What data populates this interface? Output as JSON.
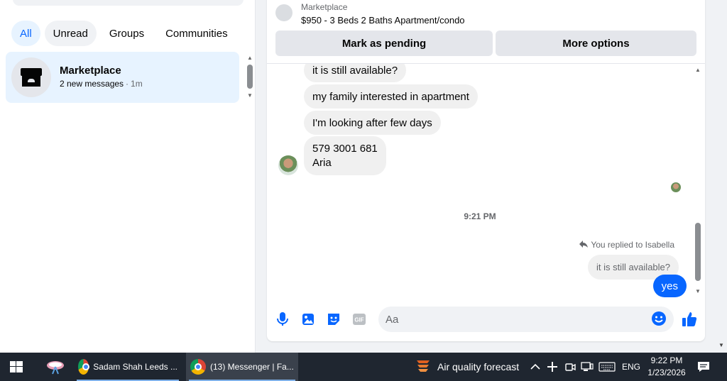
{
  "sidebar": {
    "filters": [
      {
        "label": "All",
        "active": true
      },
      {
        "label": "Unread",
        "active": false
      },
      {
        "label": "Groups",
        "active": false
      },
      {
        "label": "Communities",
        "active": false
      }
    ],
    "chats": [
      {
        "name": "Marketplace",
        "preview": "2 new messages",
        "separator": "·",
        "time": "1m",
        "icon": "marketplace-store-icon"
      }
    ]
  },
  "conversation": {
    "context": {
      "category": "Marketplace",
      "title": "$950 - 3 Beds 2 Baths Apartment/condo"
    },
    "actions": {
      "mark_pending": "Mark as pending",
      "more_options": "More options"
    },
    "incoming": [
      {
        "text": "it is still available?"
      },
      {
        "text": "my family interested in apartment"
      },
      {
        "text": "I'm looking after few days"
      },
      {
        "lines": [
          "579 3001 681",
          "Aria"
        ]
      }
    ],
    "timestamp": "9:21 PM",
    "reply_notice": "You replied to Isabella",
    "reply_quote": "it is still available?",
    "outgoing": [
      {
        "text": "yes"
      }
    ],
    "composer": {
      "placeholder": "Aa"
    }
  },
  "taskbar": {
    "apps": [
      {
        "label": "Sadam Shah Leeds ...",
        "active": false
      },
      {
        "label": "(13) Messenger | Fa...",
        "active": true
      }
    ],
    "weather": "Air quality forecast",
    "language": "ENG",
    "time": "9:22 PM",
    "date": "1/23/2026"
  },
  "colors": {
    "accent": "#0866ff",
    "bubble_incoming": "#f0f0f0",
    "active_chat_bg": "#e7f3ff",
    "taskbar_bg": "#1f2630"
  }
}
